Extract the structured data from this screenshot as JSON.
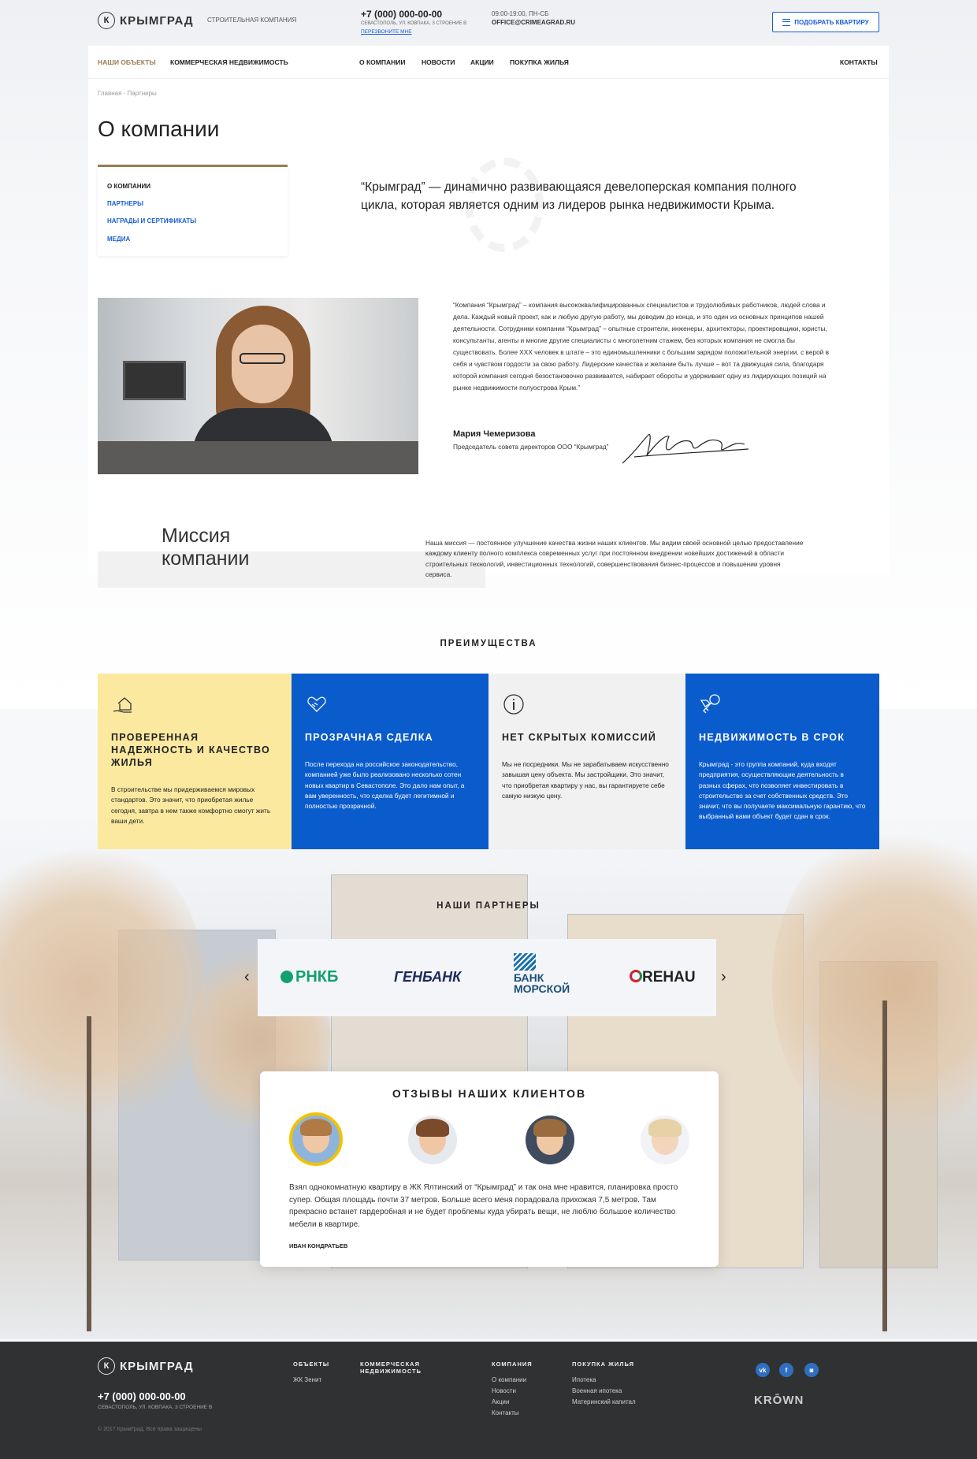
{
  "header": {
    "logo_letter": "К",
    "logo_text": "КРЫМГРАД",
    "tagline": "СТРОИТЕЛЬНАЯ КОМПАНИЯ",
    "phone": "+7 (000) 000-00-00",
    "address": "СЕВАСТОПОЛЬ, УЛ. КОВПАКА, 3 СТРОЕНИЕ В",
    "callback": "ПЕРЕЗВОНИТЕ МНЕ",
    "hours": "09:00-19:00, ПН-СБ",
    "email": "OFFICE@CRIMEAGRAD.RU",
    "pick_button": "ПОДОБРАТЬ КВАРТИРУ"
  },
  "nav": {
    "items": [
      "НАШИ ОБЪЕКТЫ",
      "КОММЕРЧЕСКАЯ НЕДВИЖИМОСТЬ",
      "О КОМПАНИИ",
      "НОВОСТИ",
      "АКЦИИ",
      "ПОКУПКА ЖИЛЬЯ",
      "КОНТАКТЫ"
    ],
    "active": "НАШИ ОБЪЕКТЫ"
  },
  "breadcrumb": "Главная - Партнеры",
  "page_title": "О компании",
  "side_menu": [
    "О КОМПАНИИ",
    "ПАРТНЕРЫ",
    "НАГРАДЫ И СЕРТИФИКАТЫ",
    "МЕДИА"
  ],
  "lead": "“Крымград” — динамично развивающаяся девелоперская компания полного цикла, которая является одним из лидеров рынка недвижимости Крыма.",
  "about_text": "“Компания “Крымград”  – компания высококвалифицированных специалистов и трудолюбивых работников, людей слова и дела. Каждый новый проект, как и любую другую работу, мы доводим до конца, и это один из основных принципов нашей деятельности. Сотрудники компании “Крымград” – опытные строители, инженеры, архитекторы, проектировщики, юристы, консультанты, агенты и многие другие специалисты с многолетним стажем, без которых компания не смогла бы существовать. Более ХХХ человек в штате – это единомышленники с большим зарядом положительной энергии, с верой в себя и чувством гордости за свою работу. Лидерские качества и желание быть лучше – вот та движущая сила, благодаря которой компания сегодня безостановочно развивается, набирает обороты и удерживает одну из лидирующих позиций на рынке недвижимости полуострова Крым.”",
  "ceo": {
    "name": "Мария Чемеризова",
    "role": "Председатель совета директоров ООО “Крымград”"
  },
  "mission": {
    "title_line1": "Миссия",
    "title_line2": "компании",
    "text": "Наша миссия — постоянное улучшение качества жизни наших клиентов. Мы видим своей основной целью предоставление каждому клиенту полного комплекса современных услуг при постоянном внедрении новейших достижений в области строительных технологий, инвестиционных технологий, совершенствования бизнес-процессов и повышении уровня сервиса."
  },
  "advantages": {
    "title": "ПРЕИМУЩЕСТВА",
    "items": [
      {
        "icon": "house-in-hand-icon",
        "title": "ПРОВЕРЕННАЯ НАДЕЖНОСТЬ И КАЧЕСТВО ЖИЛЬЯ",
        "text": "В строительстве мы придерживаемся мировых стандартов. Это значит, что приобретая жилье сегодня, завтра в нем также комфортно смогут жить ваши дети.",
        "bg": "#fbe9a0",
        "fg": "#222"
      },
      {
        "icon": "handshake-heart-icon",
        "title": "ПРОЗРАЧНАЯ СДЕЛКА",
        "text": "После перехода на российское законодательство, компанией уже было реализовано несколько сотен новых квартир в Севастополе. Это дало нам опыт, а вам уверенность, что сделка будет легитимной и полностью прозрачной.",
        "bg": "#0a5bcc",
        "fg": "#ffffff"
      },
      {
        "icon": "info-circle-icon",
        "title": "НЕТ СКРЫТЫХ КОМИССИЙ",
        "text": "Мы не посредники. Мы не зарабатываем искусственно завышая цену объекта. Мы застройщики. Это значит, что приобретая квартиру у нас, вы гарантируете себе самую низкую цену.",
        "bg": "#f1f1f1",
        "fg": "#222"
      },
      {
        "icon": "key-tag-icon",
        "title": "НЕДВИЖИМОСТЬ В СРОК",
        "text": "Крымград - это группа компаний, куда входят предприятия, осуществляющие деятельность в разных сферах, что позволяет инвестировать в строительство за счет собственных средств. Это значит, что вы получаете максимальную гарантию, что выбранный вами объект будет сдан в срок.",
        "bg": "#0a5bcc",
        "fg": "#ffffff"
      }
    ]
  },
  "partners": {
    "title": "НАШИ ПАРТНЕРЫ",
    "logos": [
      "РНКБ",
      "ГЕНБАНК",
      "БАНК",
      "МОРСКОЙ",
      "REHAU"
    ]
  },
  "reviews": {
    "title": "ОТЗЫВЫ НАШИХ КЛИЕНТОВ",
    "text": "Взял однокомнатную квартиру в ЖК Ялтинский от “Крымград” и так она мне нравится, планировка просто супер. Общая площадь почти 37 метров. Больше всего меня порадовала прихожая 7,5 метров. Там прекрасно встанет гардеробная и не будет проблемы куда убирать вещи, не люблю большое количество мебели в квартире.",
    "author": "ИВАН КОНДРАТЬЕВ"
  },
  "footer": {
    "logo_letter": "К",
    "logo_text": "КРЫМГРАД",
    "phone": "+7 (000) 000-00-00",
    "address": "СЕВАСТОПОЛЬ, УЛ. КОВПАКА, 3 СТРОЕНИЕ В",
    "copyright": "© 2017 КрымГрад. Все права защищены",
    "col1_title": "ОБЪЕКТЫ",
    "col1_links": [
      "ЖК Зенит"
    ],
    "col2_title_1": "КОММЕРЧЕСКАЯ",
    "col2_title_2": "НЕДВИЖИМОСТЬ",
    "col3_title": "КОМПАНИЯ",
    "col3_links": [
      "О компании",
      "Новости",
      "Акции",
      "Контакты"
    ],
    "col4_title": "ПОКУПКА ЖИЛЬЯ",
    "col4_links": [
      "Ипотека",
      "Военная ипотека",
      "Материнский капитал"
    ],
    "social": [
      "vk-icon",
      "facebook-icon",
      "instagram-icon"
    ],
    "social_labels": [
      "vk",
      "f",
      "◙"
    ],
    "developer": "KRŌWN"
  }
}
